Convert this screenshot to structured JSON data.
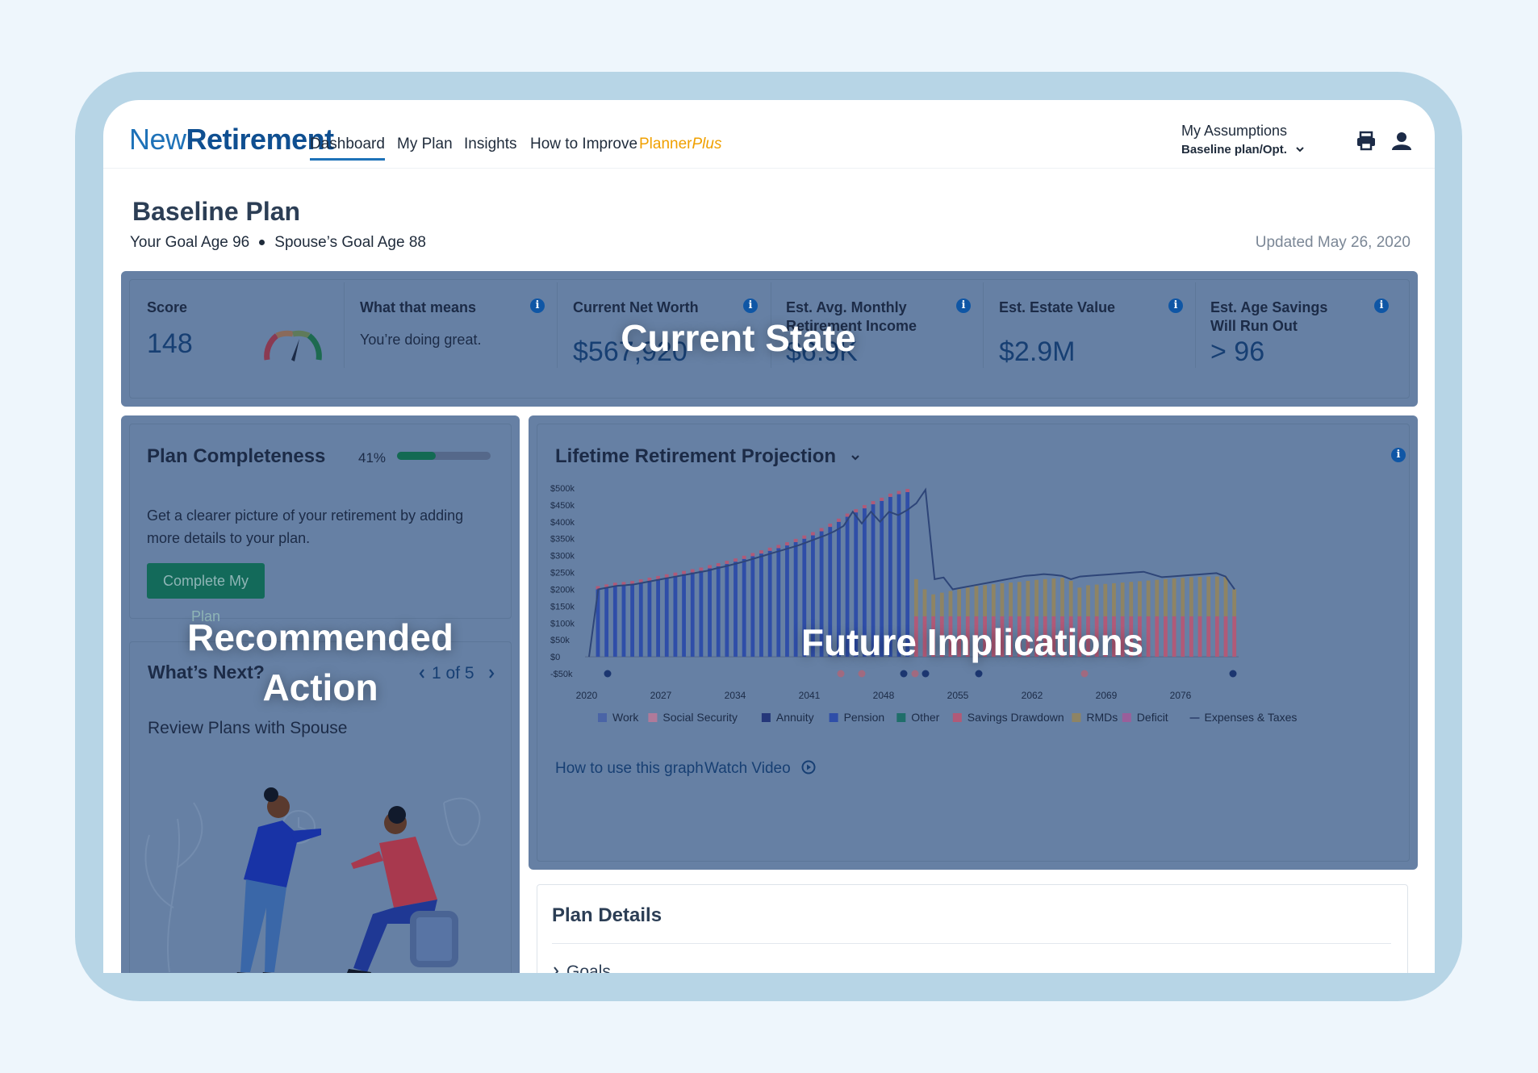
{
  "nav": {
    "logo_part1": "New",
    "logo_part2": "Retirement",
    "items": [
      {
        "label": "Dashboard"
      },
      {
        "label": "My Plan"
      },
      {
        "label": "Insights"
      },
      {
        "label": "How to Improve"
      }
    ],
    "planner_label": "Planner",
    "planner_plus": "Plus",
    "assumptions_title": "My Assumptions",
    "assumptions_value": "Baseline plan/Opt."
  },
  "page": {
    "title": "Baseline Plan",
    "goal_age": "Your Goal Age 96",
    "spouse_goal_age": "Spouse’s Goal Age 88",
    "updated": "Updated May 26, 2020"
  },
  "metrics": {
    "score_label": "Score",
    "score_value": "148",
    "meaning_label": "What that means",
    "meaning_value": "You’re doing great.",
    "net_worth_label": "Current Net Worth",
    "net_worth_value": "$567,920",
    "income_label_1": "Est. Avg. Monthly",
    "income_label_2": "Retirement Income",
    "income_value": "$6.9K",
    "estate_label": "Est. Estate Value",
    "estate_value": "$2.9M",
    "savings_label_1": "Est. Age Savings",
    "savings_label_2": "Will Run Out",
    "savings_value": "> 96"
  },
  "completeness": {
    "title": "Plan Completeness",
    "percent_text": "41%",
    "percent": 0.41,
    "body": "Get a clearer picture of your retirement by adding more details to your plan.",
    "button": "Complete My Plan"
  },
  "whats_next": {
    "title": "What’s Next?",
    "pager": "1 of 5",
    "item": "Review Plans with Spouse"
  },
  "overlays": {
    "current_state": "Current State",
    "recommended_1": "Recommended",
    "recommended_2": "Action",
    "future": "Future Implications"
  },
  "projection": {
    "title": "Lifetime Retirement Projection",
    "link_how": "How to use this graph",
    "link_video": "Watch Video"
  },
  "plan_details": {
    "title": "Plan Details",
    "first_item": "Goals"
  },
  "chart_data": {
    "type": "bar",
    "ylim": [
      -50,
      500
    ],
    "y_ticks": [
      "$500k",
      "$450k",
      "$400k",
      "$350k",
      "$300k",
      "$250k",
      "$200k",
      "$150k",
      "$100k",
      "$50k",
      "$0",
      "-$50k"
    ],
    "x_ticks": [
      "2020",
      "2027",
      "2034",
      "2041",
      "2048",
      "2055",
      "2062",
      "2069",
      "2076"
    ],
    "legend": [
      "Work",
      "Social Security",
      "Annuity",
      "Pension",
      "Other",
      "Savings Drawdown",
      "RMDs",
      "Deficit",
      "Expenses & Taxes"
    ],
    "colors": {
      "Work": "#4a64a6",
      "Social Security": "#b07a9a",
      "Annuity": "#25377a",
      "Pension": "#2f4ea8",
      "Other": "#1f6e6a",
      "Savings Drawdown": "#b05a78",
      "RMDs": "#8e8464",
      "Deficit": "#9a5f9a",
      "Expenses & Taxes": "#3a4f7a"
    },
    "work_values": [
      0,
      200,
      205,
      210,
      212,
      215,
      220,
      225,
      230,
      235,
      240,
      245,
      250,
      255,
      262,
      268,
      275,
      282,
      290,
      298,
      306,
      314,
      322,
      330,
      340,
      350,
      360,
      372,
      385,
      400,
      415,
      428,
      440,
      452,
      462,
      474,
      482,
      488
    ],
    "retire_values": [
      230,
      200,
      185,
      190,
      195,
      200,
      205,
      210,
      212,
      215,
      218,
      220,
      222,
      225,
      228,
      230,
      232,
      234,
      225,
      205,
      212,
      214,
      216,
      218,
      220,
      222,
      224,
      226,
      228,
      230,
      232,
      234,
      236,
      237,
      238,
      238,
      238,
      200
    ],
    "expenses_line": [
      0,
      200,
      205,
      210,
      212,
      215,
      220,
      225,
      230,
      235,
      240,
      245,
      250,
      255,
      262,
      268,
      275,
      282,
      290,
      298,
      306,
      314,
      322,
      330,
      340,
      350,
      360,
      372,
      388,
      430,
      395,
      430,
      400,
      430,
      420,
      435,
      455,
      495,
      230,
      235,
      200,
      205,
      210,
      215,
      220,
      225,
      230,
      235,
      240,
      242,
      245,
      243,
      240,
      230,
      238,
      240,
      242,
      244,
      246,
      248,
      250,
      252,
      244,
      236,
      238,
      240,
      242,
      244,
      246,
      248,
      238,
      200
    ],
    "deficit_dots": [
      2,
      44,
      45,
      48
    ]
  }
}
